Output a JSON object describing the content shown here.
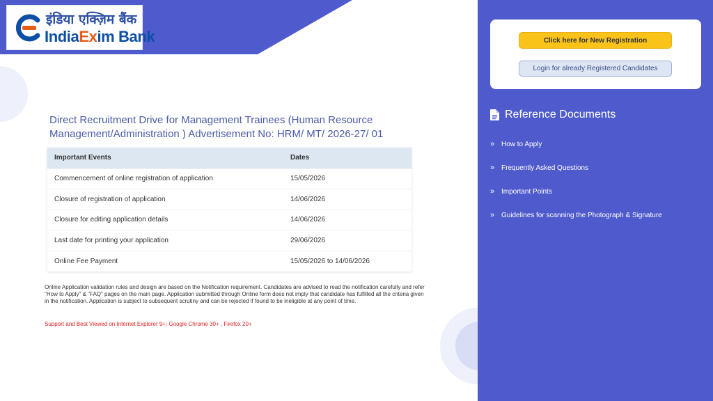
{
  "logo": {
    "hindi": "इंडिया एक्ज़िम बैंक",
    "english_main": "India",
    "english_accent": "Ex",
    "english_rest": "im Bank"
  },
  "colors": {
    "band_blue": "#4f5bcc",
    "sidebar_blue": "#4f5bcc",
    "title_blue": "#4b5ba8",
    "register_button": "#fac31a",
    "login_button": "#dfe6f3",
    "support_red": "#e02020"
  },
  "main": {
    "title": "Direct Recruitment Drive for Management Trainees (Human Resource Management/Administration ) Advertisement No: HRM/ MT/ 2026-27/ 01",
    "table": {
      "headers": [
        "Important Events",
        "Dates"
      ],
      "rows": [
        [
          "Commencement of online registration of application",
          "15/05/2026"
        ],
        [
          "Closure of registration of application",
          "14/06/2026"
        ],
        [
          "Closure for editing application details",
          "14/06/2026"
        ],
        [
          "Last date for printing your application",
          "29/06/2026"
        ],
        [
          "Online Fee Payment",
          "15/05/2026 to 14/06/2026"
        ]
      ]
    },
    "note": "Online Application validation rules and design are based on the Notification requirement. Candidates are advised to read the notification carefully and refer \"How to Apply\" & \"FAQ\" pages on the main page. Application submitted through Online form does not imply that candidate has fulfilled all the criteria given in the notification. Application is subject to subsequent scrutiny and can be rejected if found to be ineligible at any point of time.",
    "support": "Support and Best Viewed on Internet Explorer 9+; Google Chrome 30+ , Firefox 20+"
  },
  "sidebar": {
    "register_label": "Click here for New Registration",
    "login_label": "Login for already Registered Candidates",
    "reference_title": "Reference Documents",
    "reference_icon": "document-icon",
    "items": [
      {
        "label": "How to Apply",
        "icon": "double-chevron-right-icon"
      },
      {
        "label": "Frequently Asked Questions",
        "icon": "double-chevron-right-icon"
      },
      {
        "label": "Important Points",
        "icon": "double-chevron-right-icon"
      },
      {
        "label": "Guidelines for scanning the Photograph & Signature",
        "icon": "double-chevron-right-icon"
      }
    ]
  }
}
